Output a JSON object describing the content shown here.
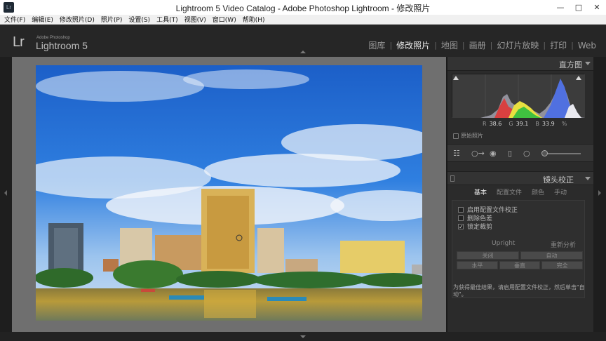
{
  "window": {
    "title": "Lightroom 5 Video Catalog - Adobe Photoshop Lightroom - 修改照片",
    "app_icon": "Lr"
  },
  "menubar": {
    "items": [
      "文件(F)",
      "编辑(E)",
      "修改照片(D)",
      "照片(P)",
      "设置(S)",
      "工具(T)",
      "视图(V)",
      "窗口(W)",
      "帮助(H)"
    ]
  },
  "identity": {
    "logo": "Lr",
    "brand_small": "Adobe Photoshop",
    "product": "Lightroom 5"
  },
  "modules": {
    "items": [
      {
        "label": "图库",
        "active": false
      },
      {
        "label": "修改照片",
        "active": true
      },
      {
        "label": "地图",
        "active": false
      },
      {
        "label": "画册",
        "active": false
      },
      {
        "label": "幻灯片放映",
        "active": false
      },
      {
        "label": "打印",
        "active": false
      },
      {
        "label": "Web",
        "active": false
      }
    ]
  },
  "histogram": {
    "title": "直方图",
    "r_label": "R",
    "r_value": "38.6",
    "g_label": "G",
    "g_value": "39.1",
    "b_label": "B",
    "b_value": "33.9",
    "percent": "%",
    "original_photo_label": "原始照片"
  },
  "lens_correction": {
    "title": "镜头校正",
    "tabs": [
      {
        "label": "基本",
        "active": true
      },
      {
        "label": "配置文件",
        "active": false
      },
      {
        "label": "颜色",
        "active": false
      },
      {
        "label": "手动",
        "active": false
      }
    ],
    "checkboxes": [
      {
        "label": "启用配置文件校正",
        "checked": false
      },
      {
        "label": "删除色差",
        "checked": false
      },
      {
        "label": "锁定裁剪",
        "checked": true
      }
    ],
    "upright_label": "Upright",
    "reanalyze_label": "重新分析",
    "upright_row1": [
      "关闭",
      "自动"
    ],
    "upright_row2": [
      "水平",
      "垂直",
      "完全"
    ],
    "hint": "为获得最佳结果，请启用配置文件校正，然后单击\"自动\"。"
  },
  "colors": {
    "accent_active_text": "#f0f0f0",
    "panel_bg": "#2b2b2b",
    "canvas_bg": "#6f6f6f"
  }
}
